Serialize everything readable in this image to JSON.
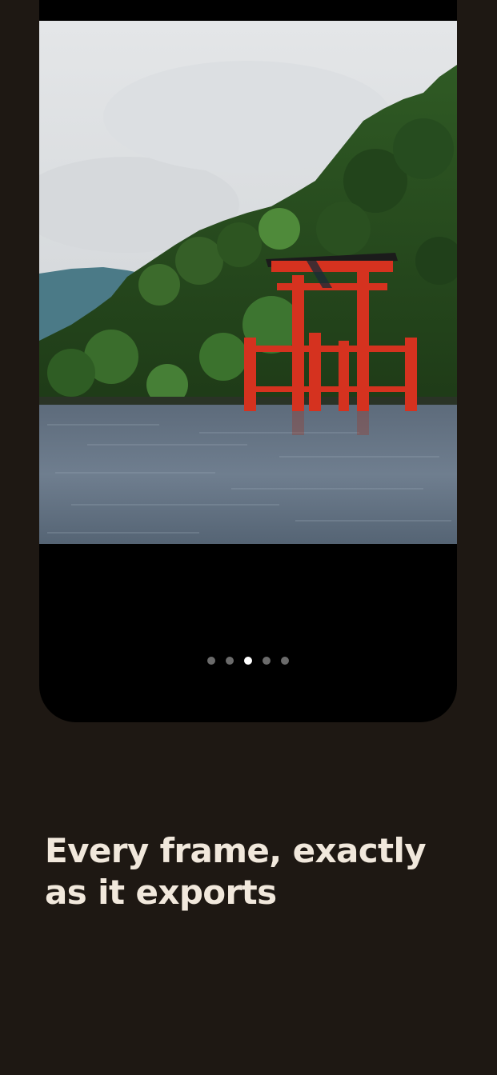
{
  "screen": {
    "background_color": "#1e1813",
    "frame_color": "#000000"
  },
  "preview": {
    "image_description": "Red torii gate standing in a lake in front of a forested hillside under an overcast sky",
    "pager": {
      "count": 5,
      "active_index": 2,
      "active_color": "#ffffff",
      "inactive_color": "#6b6b6b"
    }
  },
  "headline": {
    "line1": "Every frame, exactly",
    "line2": "as it exports",
    "color": "#f1e8dc"
  }
}
